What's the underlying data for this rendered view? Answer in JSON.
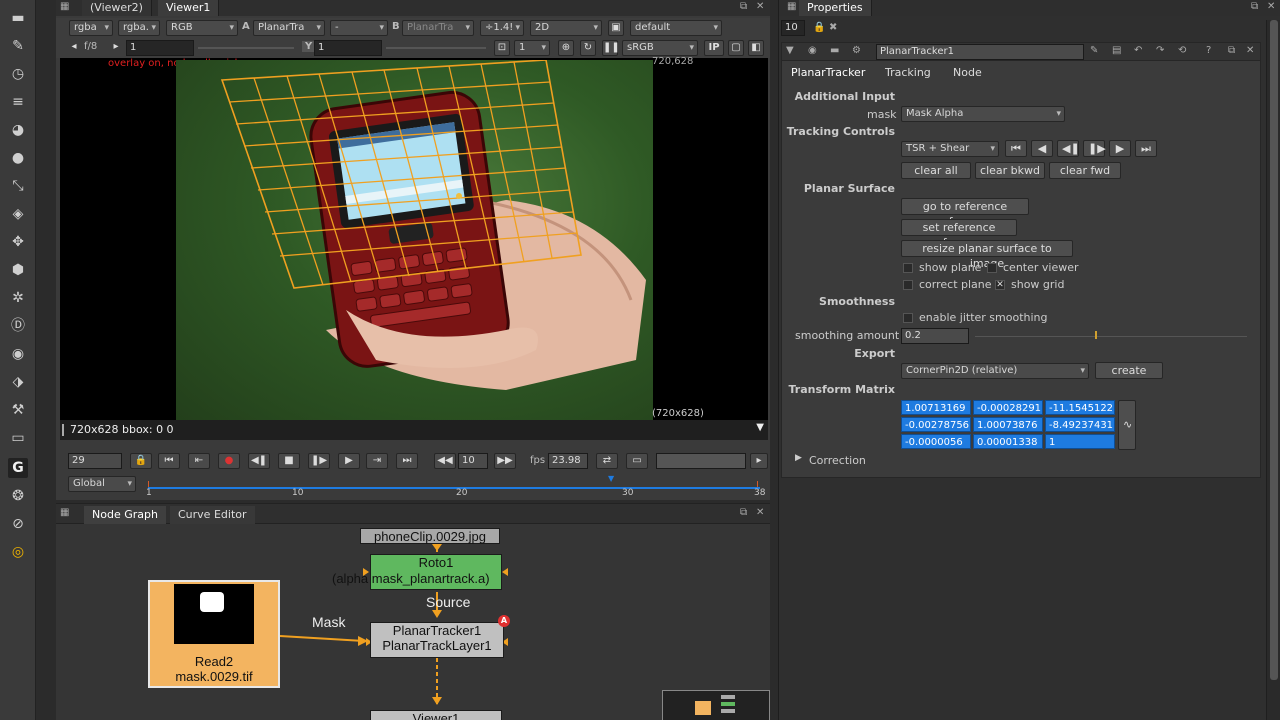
{
  "viewer": {
    "tabs": [
      "(Viewer2)",
      "Viewer1"
    ],
    "row1": {
      "layer": "rgba",
      "channel": "rgba.",
      "display_channel": "RGB",
      "a_label": "A",
      "a_input": "PlanarTra",
      "b_operation": "-",
      "b_label": "B",
      "b_input": "PlanarTra",
      "gain": "÷1.4!",
      "mode": "2D",
      "lut_label": "default"
    },
    "row2": {
      "fstop": "f/8",
      "gain_value": "1",
      "y_label": "Y",
      "gamma_value": "1",
      "downscale": "1",
      "colorspace": "sRGB",
      "ip_label": "IP"
    },
    "overlay_info": "overlay on, no handle pick",
    "res_top": "720,628",
    "res_bottom": "(720x628)",
    "status": "720x628 bbox: 0 0",
    "timeline": {
      "frame": "29",
      "increment": "10",
      "fps_label": "fps",
      "fps": "23.98",
      "range_mode": "Global",
      "ticks": [
        "1",
        "10",
        "20",
        "30",
        "38"
      ]
    }
  },
  "node_graph": {
    "tabs": [
      "Node Graph",
      "Curve Editor"
    ],
    "nodes": {
      "phone_clip": "phoneClip.0029.jpg",
      "roto_title": "Roto1",
      "roto_sub": "(alpha mask_planartrack.a)",
      "source_label": "Source",
      "planar_title": "PlanarTracker1",
      "planar_sub": "PlanarTrackLayer1",
      "mask_label": "Mask",
      "read_title": "Read2",
      "read_sub": "mask.0029.tif",
      "viewer_node": "Viewer1"
    }
  },
  "properties": {
    "title": "Properties",
    "count": "10",
    "node_name": "PlanarTracker1",
    "tabs": [
      "PlanarTracker",
      "Tracking",
      "Node"
    ],
    "additional_input": "Additional Input",
    "mask_label": "mask",
    "mask_value": "Mask Alpha",
    "tracking_controls": "Tracking Controls",
    "track_mode": "TSR + Shear",
    "clear_all": "clear all",
    "clear_bkwd": "clear bkwd",
    "clear_fwd": "clear fwd",
    "planar_surface": "Planar Surface",
    "goto_ref": "go to reference frame",
    "set_ref": "set reference frame",
    "resize_surface": "resize planar surface to image",
    "show_plane": "show plane",
    "center_viewer": "center viewer",
    "correct_plane": "correct plane",
    "show_grid": "show grid",
    "smoothness": "Smoothness",
    "jitter": "enable jitter smoothing",
    "smoothing_label": "smoothing amount",
    "smoothing_value": "0.2",
    "export": "Export",
    "export_value": "CornerPin2D (relative)",
    "create": "create",
    "transform_matrix": "Transform Matrix",
    "matrix": [
      [
        "1.00713169",
        "-0.00028291",
        "-11.1545122"
      ],
      [
        "-0.00278756",
        "1.00073876",
        "-8.49237431"
      ],
      [
        "-0.0000056",
        "0.00001338",
        "1"
      ]
    ],
    "correction": "Correction"
  }
}
